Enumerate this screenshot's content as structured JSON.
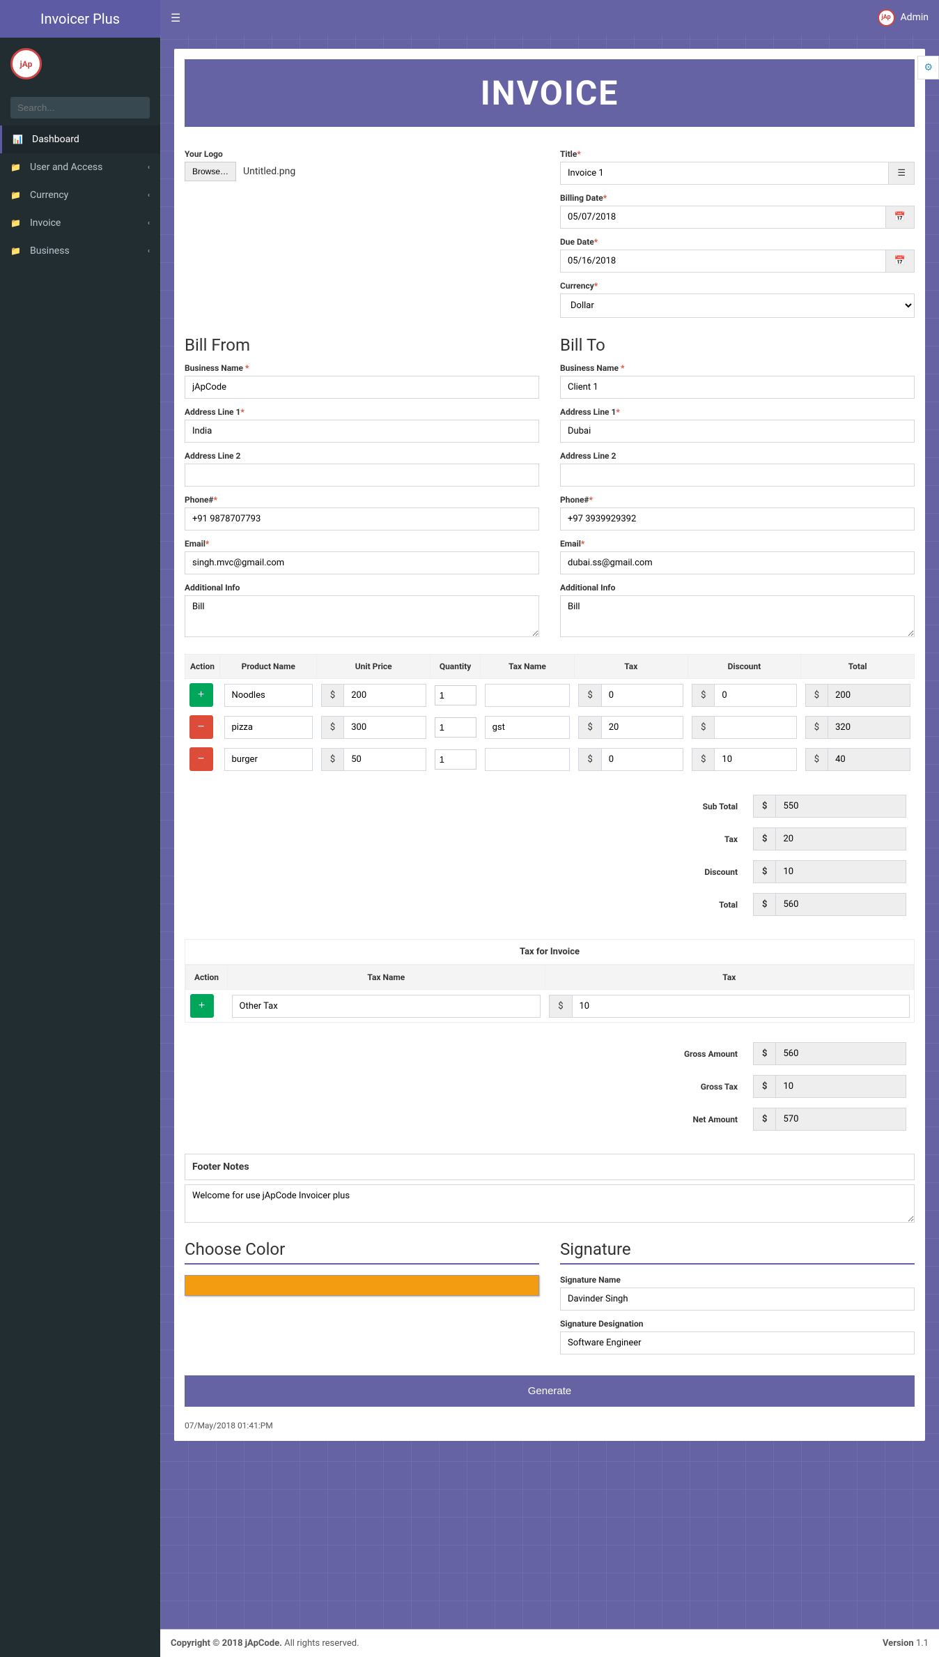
{
  "app": {
    "name": "Invoicer Plus",
    "user": "Admin"
  },
  "search": {
    "placeholder": "Search..."
  },
  "menu": [
    {
      "icon": "⚙",
      "label": "Dashboard",
      "active": true,
      "expandable": false
    },
    {
      "icon": "📁",
      "label": "User and Access",
      "active": false,
      "expandable": true
    },
    {
      "icon": "📁",
      "label": "Currency",
      "active": false,
      "expandable": true
    },
    {
      "icon": "📁",
      "label": "Invoice",
      "active": false,
      "expandable": true
    },
    {
      "icon": "📁",
      "label": "Business",
      "active": false,
      "expandable": true
    }
  ],
  "banner": "INVOICE",
  "logo": {
    "label": "Your Logo",
    "browse": "Browse…",
    "file": "Untitled.png"
  },
  "meta": {
    "title_label": "Title",
    "title": "Invoice 1",
    "billing_label": "Billing Date",
    "billing": "05/07/2018",
    "due_label": "Due Date",
    "due": "05/16/2018",
    "currency_label": "Currency",
    "currency": "Dollar"
  },
  "from": {
    "heading": "Bill From",
    "business_label": "Business Name",
    "business": "jApCode",
    "addr1_label": "Address Line 1",
    "addr1": "India",
    "addr2_label": "Address Line 2",
    "addr2": "",
    "phone_label": "Phone#",
    "phone": "+91 9878707793",
    "email_label": "Email",
    "email": "singh.mvc@gmail.com",
    "info_label": "Additional Info",
    "info": "Bill"
  },
  "to": {
    "heading": "Bill To",
    "business_label": "Business Name",
    "business": "Client 1",
    "addr1_label": "Address Line 1",
    "addr1": "Dubai",
    "addr2_label": "Address Line 2",
    "addr2": "",
    "phone_label": "Phone#",
    "phone": "+97 3939929392",
    "email_label": "Email",
    "email": "dubai.ss@gmail.com",
    "info_label": "Additional Info",
    "info": "Bill"
  },
  "items": {
    "headers": [
      "Action",
      "Product Name",
      "Unit Price",
      "Quantity",
      "Tax Name",
      "Tax",
      "Discount",
      "Total"
    ],
    "rows": [
      {
        "action": "add",
        "name": "Noodles",
        "price": "200",
        "qty": "1",
        "taxname": "",
        "tax": "0",
        "discount": "0",
        "total": "200"
      },
      {
        "action": "remove",
        "name": "pizza",
        "price": "300",
        "qty": "1",
        "taxname": "gst",
        "tax": "20",
        "discount": "",
        "total": "320"
      },
      {
        "action": "remove",
        "name": "burger",
        "price": "50",
        "qty": "1",
        "taxname": "",
        "tax": "0",
        "discount": "10",
        "total": "40"
      }
    ]
  },
  "totals": {
    "subtotal_label": "Sub Total",
    "subtotal": "550",
    "tax_label": "Tax",
    "tax": "20",
    "discount_label": "Discount",
    "discount": "10",
    "total_label": "Total",
    "total": "560"
  },
  "taxsec": {
    "header": "Tax for Invoice",
    "cols": [
      "Action",
      "Tax Name",
      "Tax"
    ],
    "row": {
      "name": "Other Tax",
      "tax": "10"
    }
  },
  "gross": {
    "amount_label": "Gross Amount",
    "amount": "560",
    "tax_label": "Gross Tax",
    "tax": "10",
    "net_label": "Net Amount",
    "net": "570"
  },
  "footernotes": {
    "label": "Footer Notes",
    "text": "Welcome for use jApCode Invoicer plus"
  },
  "color": {
    "heading": "Choose Color"
  },
  "signature": {
    "heading": "Signature",
    "name_label": "Signature Name",
    "name": "Davinder Singh",
    "desig_label": "Signature Designation",
    "desig": "Software Engineer"
  },
  "generate": "Generate",
  "timestamp": "07/May/2018 01:41:PM",
  "footer": {
    "copyright": "Copyright © 2018 jApCode.",
    "rights": " All rights reserved.",
    "version_label": "Version ",
    "version": "1.1"
  },
  "currency_symbol": "$"
}
